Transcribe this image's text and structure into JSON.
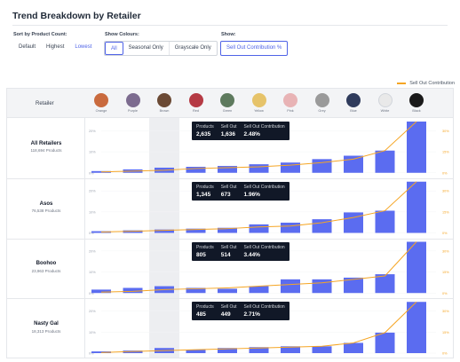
{
  "title": "Trend Breakdown by Retailer",
  "sort": {
    "label": "Sort by Product Count:",
    "options": [
      "Default",
      "Highest",
      "Lowest"
    ],
    "active": "Lowest"
  },
  "colours": {
    "label": "Show Colours:",
    "options": [
      "All",
      "Seasonal Only",
      "Grayscale Only"
    ],
    "active": "All"
  },
  "show": {
    "label": "Show:",
    "options": [
      "Sell Out Contribution %"
    ],
    "active": "Sell Out Contribution %"
  },
  "legend": {
    "label": "Sell Out Contribution",
    "color": "#f5a524"
  },
  "table": {
    "retailer_header": "Retailer",
    "swatches": [
      {
        "name": "Orange",
        "color": "#c96a3e"
      },
      {
        "name": "Purple",
        "color": "#7c6b8f"
      },
      {
        "name": "Brown",
        "color": "#6b4a35"
      },
      {
        "name": "Red",
        "color": "#b53a44"
      },
      {
        "name": "Green",
        "color": "#5e7a5e"
      },
      {
        "name": "Yellow",
        "color": "#e6c36a"
      },
      {
        "name": "Pink",
        "color": "#e8b3b5"
      },
      {
        "name": "Grey",
        "color": "#9a9a9a"
      },
      {
        "name": "Blue",
        "color": "#2f3b5c"
      },
      {
        "name": "White",
        "color": "#e9e9e9"
      },
      {
        "name": "Black",
        "color": "#1a1a1a"
      }
    ],
    "highlight_index": 2
  },
  "tooltip_labels": {
    "products": "Products",
    "sell_out": "Sell Out",
    "contribution": "Sell Out Contribution"
  },
  "rows": [
    {
      "name": "All Retailers",
      "count": "118,694 Products",
      "tooltip": {
        "products": "2,635",
        "sell_out": "1,636",
        "contribution": "2.48%"
      },
      "y_left": [
        "20%",
        "10%",
        "0%"
      ],
      "y_right": [
        "30%",
        "15%",
        "0%"
      ]
    },
    {
      "name": "Asos",
      "count": "76,538 Products",
      "tooltip": {
        "products": "1,345",
        "sell_out": "673",
        "contribution": "1.96%"
      },
      "y_left": [
        "20%",
        "10%",
        "0%"
      ],
      "y_right": [
        "30%",
        "15%",
        "0%"
      ]
    },
    {
      "name": "Boohoo",
      "count": "23,963 Products",
      "tooltip": {
        "products": "805",
        "sell_out": "514",
        "contribution": "3.44%"
      },
      "y_left": [
        "20%",
        "10%",
        "0%"
      ],
      "y_right": [
        "30%",
        "15%",
        "0%"
      ]
    },
    {
      "name": "Nasty Gal",
      "count": "18,313 Products",
      "tooltip": {
        "products": "485",
        "sell_out": "449",
        "contribution": "2.71%"
      },
      "y_left": [
        "20%",
        "10%",
        "0%"
      ],
      "y_right": [
        "30%",
        "15%",
        "0%"
      ]
    }
  ],
  "chart_data": {
    "type": "bar",
    "categories": [
      "Orange",
      "Purple",
      "Brown",
      "Red",
      "Green",
      "Yellow",
      "Pink",
      "Grey",
      "Blue",
      "White",
      "Black"
    ],
    "bar_color": "#5b6cf0",
    "line_color": "#f5a524",
    "ylim": [
      0,
      30
    ],
    "panels": [
      {
        "retailer": "All Retailers",
        "bars": [
          1,
          2,
          3,
          3.5,
          4,
          5,
          6,
          8,
          10,
          13,
          30
        ],
        "line": [
          0.5,
          1,
          1.5,
          2.5,
          3,
          3.5,
          4.5,
          6,
          8,
          13,
          30
        ]
      },
      {
        "retailer": "Asos",
        "bars": [
          1,
          1.5,
          2,
          2.5,
          3,
          5,
          6,
          8,
          12,
          13,
          30
        ],
        "line": [
          0.5,
          1,
          1.5,
          2,
          2.5,
          3.5,
          4,
          6,
          9,
          13,
          30
        ]
      },
      {
        "retailer": "Boohoo",
        "bars": [
          2,
          3,
          4,
          3,
          2.5,
          4,
          8,
          8,
          9,
          11,
          30
        ],
        "line": [
          0.5,
          1,
          2,
          2.5,
          3,
          4,
          5,
          6,
          8,
          10,
          30
        ]
      },
      {
        "retailer": "Nasty Gal",
        "bars": [
          1,
          1.5,
          3,
          2,
          3,
          3.5,
          4,
          4,
          6,
          12,
          30
        ],
        "line": [
          0.3,
          1,
          1.5,
          2,
          2.5,
          3,
          3.5,
          4,
          6,
          12,
          30
        ]
      }
    ]
  }
}
